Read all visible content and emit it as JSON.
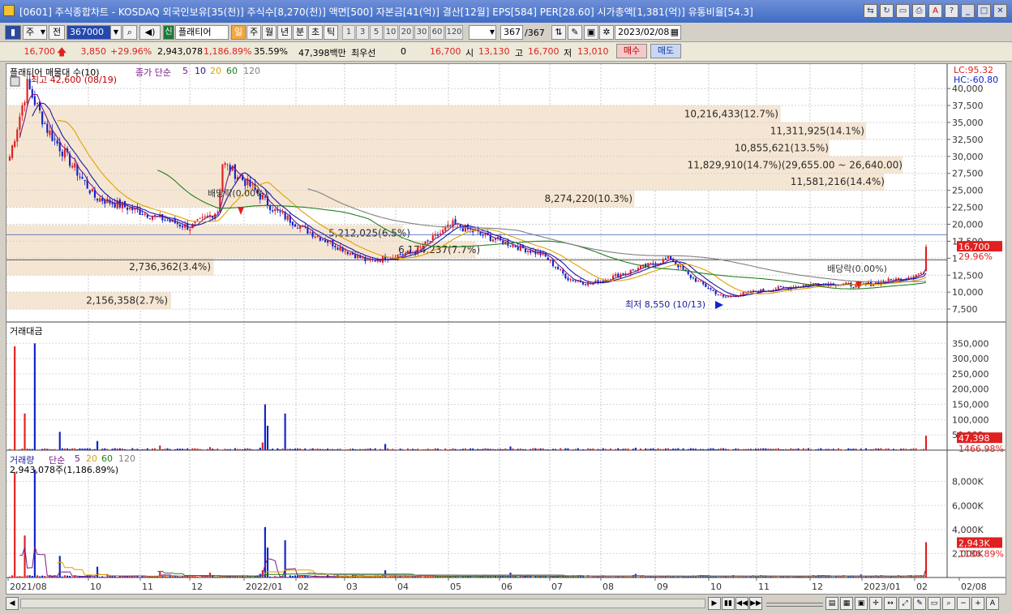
{
  "window": {
    "title": "[0601] 주식종합차트 - KOSDAQ 외국인보유[35(천)] 주식수[8,270(천)] 액면[500] 자본금[41(억)] 결산[12월] EPS[584] PER[28.60] 시가총액[1,381(억)] 유통비율[54.3]"
  },
  "toolbar": {
    "market_select": "주",
    "prev_label": "전",
    "code": "367000",
    "stock_type_badge": "신",
    "stock_name": "플래티어",
    "period_buttons": [
      "일",
      "주",
      "월",
      "년",
      "분",
      "초",
      "틱"
    ],
    "active_period": "일",
    "minute_options": [
      "1",
      "3",
      "5",
      "10",
      "20",
      "30",
      "60",
      "120"
    ],
    "count_value": "367",
    "count_total": "/367",
    "date_value": "2023/02/08"
  },
  "quote": {
    "price": "16,700",
    "change": "3,850",
    "change_pct": "+29.96%",
    "volume": "2,943,078",
    "volume_ratio": "1,186.89%",
    "turnover_pct": "35.59%",
    "amount": "47,398백만",
    "priority_label": "최우선",
    "priority_value": "0",
    "ask": "16,700",
    "open_label": "시",
    "open": "13,130",
    "high_label": "고",
    "high": "16,700",
    "low_label": "저",
    "low": "13,010",
    "buy_label": "매수",
    "sell_label": "매도"
  },
  "colors": {
    "up": "#e02020",
    "down": "#1024c8",
    "ma5": "#7a1a8a",
    "ma10": "#1a1a9a",
    "ma20": "#e0a000",
    "ma60": "#208020",
    "ma120": "#808080",
    "band": "#f5e6d3"
  },
  "chart_data": [
    {
      "type": "candlestick",
      "title": "플래티어 매물대 수(10)",
      "ma_label": "종가 단순",
      "ma_periods": [
        "5",
        "10",
        "20",
        "60",
        "120"
      ],
      "right_labels": {
        "lc": "LC:95.32",
        "hc": "HC:-60.80"
      },
      "y_ticks": [
        40000,
        37500,
        35000,
        32500,
        30000,
        27500,
        25000,
        22500,
        20000,
        17500,
        15000,
        12500,
        10000,
        7500
      ],
      "y_tick_labels": [
        "40,000",
        "37,500",
        "35,000",
        "32,500",
        "30,000",
        "27,500",
        "25,000",
        "22,500",
        "20,000",
        "17,500",
        "15,000",
        "12,500",
        "10,000",
        "7,500"
      ],
      "ylim": [
        5600,
        43600
      ],
      "x_tick_labels": [
        "2021/08",
        "10",
        "11",
        "12",
        "2022/01",
        "02",
        "03",
        "04",
        "05",
        "06",
        "07",
        "08",
        "09",
        "10",
        "11",
        "12",
        "2023/01",
        "02",
        "02/08"
      ],
      "last_price_label": "16,700",
      "last_pct_label": "29.96%",
      "annotations": {
        "high": "최고 42,600 (08/19)",
        "low": "최저 8,550 (10/13)",
        "dividend1": "배당락(0.00%)",
        "dividend2": "배당락(0.00%)"
      },
      "volume_profile": [
        {
          "label": "10,216,433(12.7%)",
          "low": 35000,
          "high": 37500
        },
        {
          "label": "11,311,925(14.1%)",
          "low": 32500,
          "high": 35000
        },
        {
          "label": "10,855,621(13.5%)",
          "low": 30000,
          "high": 32500
        },
        {
          "label": "11,829,910(14.7%)(29,655.00 ~ 26,640.00)",
          "low": 27500,
          "high": 30000
        },
        {
          "label": "11,581,216(14.4%)",
          "low": 25000,
          "high": 27500
        },
        {
          "label": "8,274,220(10.3%)",
          "low": 22500,
          "high": 25000
        },
        {
          "label": "5,212,025(6.5%)",
          "low": 17500,
          "high": 19900
        },
        {
          "label": "6,174,237(7.7%)",
          "low": 15000,
          "high": 17500
        },
        {
          "label": "2,736,362(3.4%)",
          "low": 12500,
          "high": 15000
        },
        {
          "label": "2,156,358(2.7%)",
          "low": 7500,
          "high": 10000
        }
      ],
      "series": [
        {
          "name": "종가",
          "x": [
            "2021/08",
            "2021/09",
            "2021/10",
            "2021/11",
            "2021/11",
            "2021/12",
            "2022/01",
            "2022/02",
            "2022/03",
            "2022/04",
            "2022/05",
            "2022/06",
            "2022/07",
            "2022/08",
            "2022/09",
            "2022/10",
            "2022/11",
            "2022/12",
            "2023/01",
            "2023/02/08"
          ],
          "values": [
            38000,
            26000,
            22000,
            18000,
            28000,
            23000,
            19000,
            14500,
            15500,
            19000,
            16500,
            14000,
            11000,
            12500,
            15000,
            8800,
            9800,
            11000,
            11500,
            16700
          ]
        }
      ]
    },
    {
      "type": "bar",
      "title": "거래대금",
      "y_tick_labels": [
        "350,000",
        "300,000",
        "250,000",
        "200,000",
        "150,000",
        "100,000",
        "50,000"
      ],
      "ylim": [
        0,
        380000
      ],
      "last_value_label": "47,398",
      "last_pct_label": "1466.98%",
      "values": [
        340000,
        120000,
        350000,
        60000,
        30000,
        15000,
        10000,
        8000,
        25000,
        150000,
        80000,
        120000,
        20000,
        12000,
        8000,
        6000,
        5000,
        4000,
        47398
      ]
    },
    {
      "type": "bar",
      "title": "거래량",
      "ma_label": "단순",
      "ma_periods": [
        "5",
        "20",
        "60",
        "120"
      ],
      "subtitle": "2,943,078주(1,186.89%)",
      "y_tick_labels": [
        "8,000K",
        "6,000K",
        "4,000K",
        "2,000K"
      ],
      "ylim": [
        0,
        9600
      ],
      "last_value_label": "2,943K",
      "last_pct_label": "1186.89%",
      "values": [
        8800,
        3500,
        9000,
        1800,
        900,
        500,
        400,
        300,
        600,
        4200,
        2500,
        3100,
        600,
        400,
        300,
        200,
        250,
        200,
        2943
      ]
    }
  ],
  "status": {
    "nav_buttons": [
      "play",
      "first",
      "prev",
      "last"
    ],
    "tools": [
      "zoom-out",
      "zoom-in",
      "text"
    ]
  }
}
